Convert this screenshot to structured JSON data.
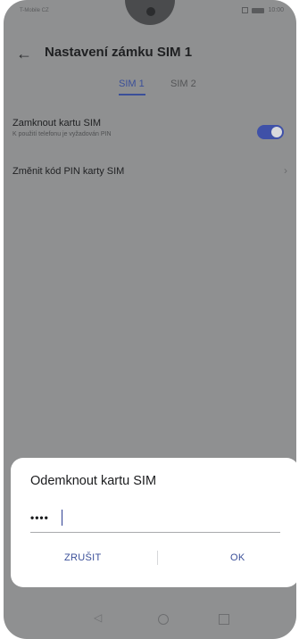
{
  "status_bar": {
    "carrier": "T-Mobile CZ",
    "time": "10:00",
    "icons": [
      "signal-icon",
      "sim-icon",
      "battery-icon"
    ]
  },
  "header": {
    "back_icon": "arrow-left-icon",
    "title": "Nastavení zámku SIM 1"
  },
  "tabs": [
    {
      "label": "SIM 1",
      "active": true
    },
    {
      "label": "SIM 2",
      "active": false
    }
  ],
  "settings": {
    "lock_sim": {
      "title": "Zamknout kartu SIM",
      "subtitle": "K použití telefonu je vyžadován PIN",
      "toggle_on": true
    },
    "change_pin": {
      "title": "Změnit kód PIN karty SIM"
    }
  },
  "dialog": {
    "title": "Odemknout kartu SIM",
    "pin_value": "••••",
    "cancel_label": "ZRUŠIT",
    "ok_label": "OK"
  },
  "colors": {
    "accent": "#3f51a8",
    "dim_background": "#8f9091",
    "dialog_background": "#ffffff"
  }
}
